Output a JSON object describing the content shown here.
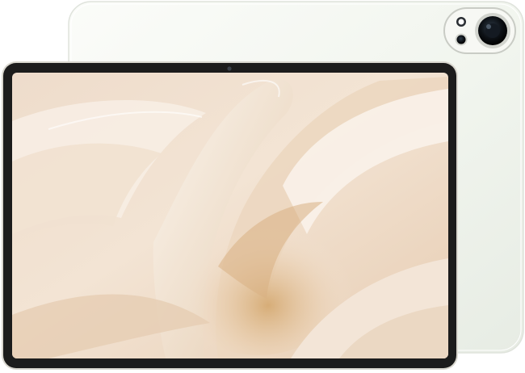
{
  "product": {
    "colors": {
      "back_body": "#f2f5ef",
      "bezel": "#1c1c1c",
      "frame": "#d9d7cf",
      "wallpaper_base": "#ead8c6",
      "wallpaper_accent": "#f7efe6"
    },
    "icons": {
      "front_camera": "front-camera-icon",
      "rear_camera_main": "rear-camera-main-icon",
      "rear_camera_secondary": "rear-camera-secondary-icon",
      "flash": "flash-icon"
    }
  }
}
